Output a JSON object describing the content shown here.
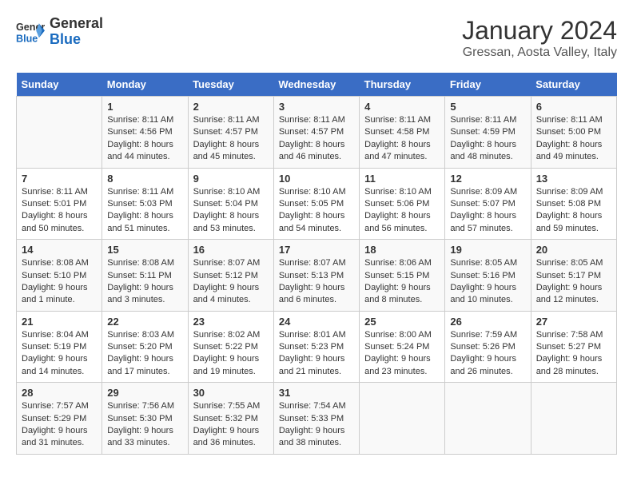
{
  "header": {
    "logo_line1": "General",
    "logo_line2": "Blue",
    "title": "January 2024",
    "subtitle": "Gressan, Aosta Valley, Italy"
  },
  "weekdays": [
    "Sunday",
    "Monday",
    "Tuesday",
    "Wednesday",
    "Thursday",
    "Friday",
    "Saturday"
  ],
  "weeks": [
    [
      {
        "day": "",
        "info": ""
      },
      {
        "day": "1",
        "info": "Sunrise: 8:11 AM\nSunset: 4:56 PM\nDaylight: 8 hours\nand 44 minutes."
      },
      {
        "day": "2",
        "info": "Sunrise: 8:11 AM\nSunset: 4:57 PM\nDaylight: 8 hours\nand 45 minutes."
      },
      {
        "day": "3",
        "info": "Sunrise: 8:11 AM\nSunset: 4:57 PM\nDaylight: 8 hours\nand 46 minutes."
      },
      {
        "day": "4",
        "info": "Sunrise: 8:11 AM\nSunset: 4:58 PM\nDaylight: 8 hours\nand 47 minutes."
      },
      {
        "day": "5",
        "info": "Sunrise: 8:11 AM\nSunset: 4:59 PM\nDaylight: 8 hours\nand 48 minutes."
      },
      {
        "day": "6",
        "info": "Sunrise: 8:11 AM\nSunset: 5:00 PM\nDaylight: 8 hours\nand 49 minutes."
      }
    ],
    [
      {
        "day": "7",
        "info": "Sunrise: 8:11 AM\nSunset: 5:01 PM\nDaylight: 8 hours\nand 50 minutes."
      },
      {
        "day": "8",
        "info": "Sunrise: 8:11 AM\nSunset: 5:03 PM\nDaylight: 8 hours\nand 51 minutes."
      },
      {
        "day": "9",
        "info": "Sunrise: 8:10 AM\nSunset: 5:04 PM\nDaylight: 8 hours\nand 53 minutes."
      },
      {
        "day": "10",
        "info": "Sunrise: 8:10 AM\nSunset: 5:05 PM\nDaylight: 8 hours\nand 54 minutes."
      },
      {
        "day": "11",
        "info": "Sunrise: 8:10 AM\nSunset: 5:06 PM\nDaylight: 8 hours\nand 56 minutes."
      },
      {
        "day": "12",
        "info": "Sunrise: 8:09 AM\nSunset: 5:07 PM\nDaylight: 8 hours\nand 57 minutes."
      },
      {
        "day": "13",
        "info": "Sunrise: 8:09 AM\nSunset: 5:08 PM\nDaylight: 8 hours\nand 59 minutes."
      }
    ],
    [
      {
        "day": "14",
        "info": "Sunrise: 8:08 AM\nSunset: 5:10 PM\nDaylight: 9 hours\nand 1 minute."
      },
      {
        "day": "15",
        "info": "Sunrise: 8:08 AM\nSunset: 5:11 PM\nDaylight: 9 hours\nand 3 minutes."
      },
      {
        "day": "16",
        "info": "Sunrise: 8:07 AM\nSunset: 5:12 PM\nDaylight: 9 hours\nand 4 minutes."
      },
      {
        "day": "17",
        "info": "Sunrise: 8:07 AM\nSunset: 5:13 PM\nDaylight: 9 hours\nand 6 minutes."
      },
      {
        "day": "18",
        "info": "Sunrise: 8:06 AM\nSunset: 5:15 PM\nDaylight: 9 hours\nand 8 minutes."
      },
      {
        "day": "19",
        "info": "Sunrise: 8:05 AM\nSunset: 5:16 PM\nDaylight: 9 hours\nand 10 minutes."
      },
      {
        "day": "20",
        "info": "Sunrise: 8:05 AM\nSunset: 5:17 PM\nDaylight: 9 hours\nand 12 minutes."
      }
    ],
    [
      {
        "day": "21",
        "info": "Sunrise: 8:04 AM\nSunset: 5:19 PM\nDaylight: 9 hours\nand 14 minutes."
      },
      {
        "day": "22",
        "info": "Sunrise: 8:03 AM\nSunset: 5:20 PM\nDaylight: 9 hours\nand 17 minutes."
      },
      {
        "day": "23",
        "info": "Sunrise: 8:02 AM\nSunset: 5:22 PM\nDaylight: 9 hours\nand 19 minutes."
      },
      {
        "day": "24",
        "info": "Sunrise: 8:01 AM\nSunset: 5:23 PM\nDaylight: 9 hours\nand 21 minutes."
      },
      {
        "day": "25",
        "info": "Sunrise: 8:00 AM\nSunset: 5:24 PM\nDaylight: 9 hours\nand 23 minutes."
      },
      {
        "day": "26",
        "info": "Sunrise: 7:59 AM\nSunset: 5:26 PM\nDaylight: 9 hours\nand 26 minutes."
      },
      {
        "day": "27",
        "info": "Sunrise: 7:58 AM\nSunset: 5:27 PM\nDaylight: 9 hours\nand 28 minutes."
      }
    ],
    [
      {
        "day": "28",
        "info": "Sunrise: 7:57 AM\nSunset: 5:29 PM\nDaylight: 9 hours\nand 31 minutes."
      },
      {
        "day": "29",
        "info": "Sunrise: 7:56 AM\nSunset: 5:30 PM\nDaylight: 9 hours\nand 33 minutes."
      },
      {
        "day": "30",
        "info": "Sunrise: 7:55 AM\nSunset: 5:32 PM\nDaylight: 9 hours\nand 36 minutes."
      },
      {
        "day": "31",
        "info": "Sunrise: 7:54 AM\nSunset: 5:33 PM\nDaylight: 9 hours\nand 38 minutes."
      },
      {
        "day": "",
        "info": ""
      },
      {
        "day": "",
        "info": ""
      },
      {
        "day": "",
        "info": ""
      }
    ]
  ]
}
